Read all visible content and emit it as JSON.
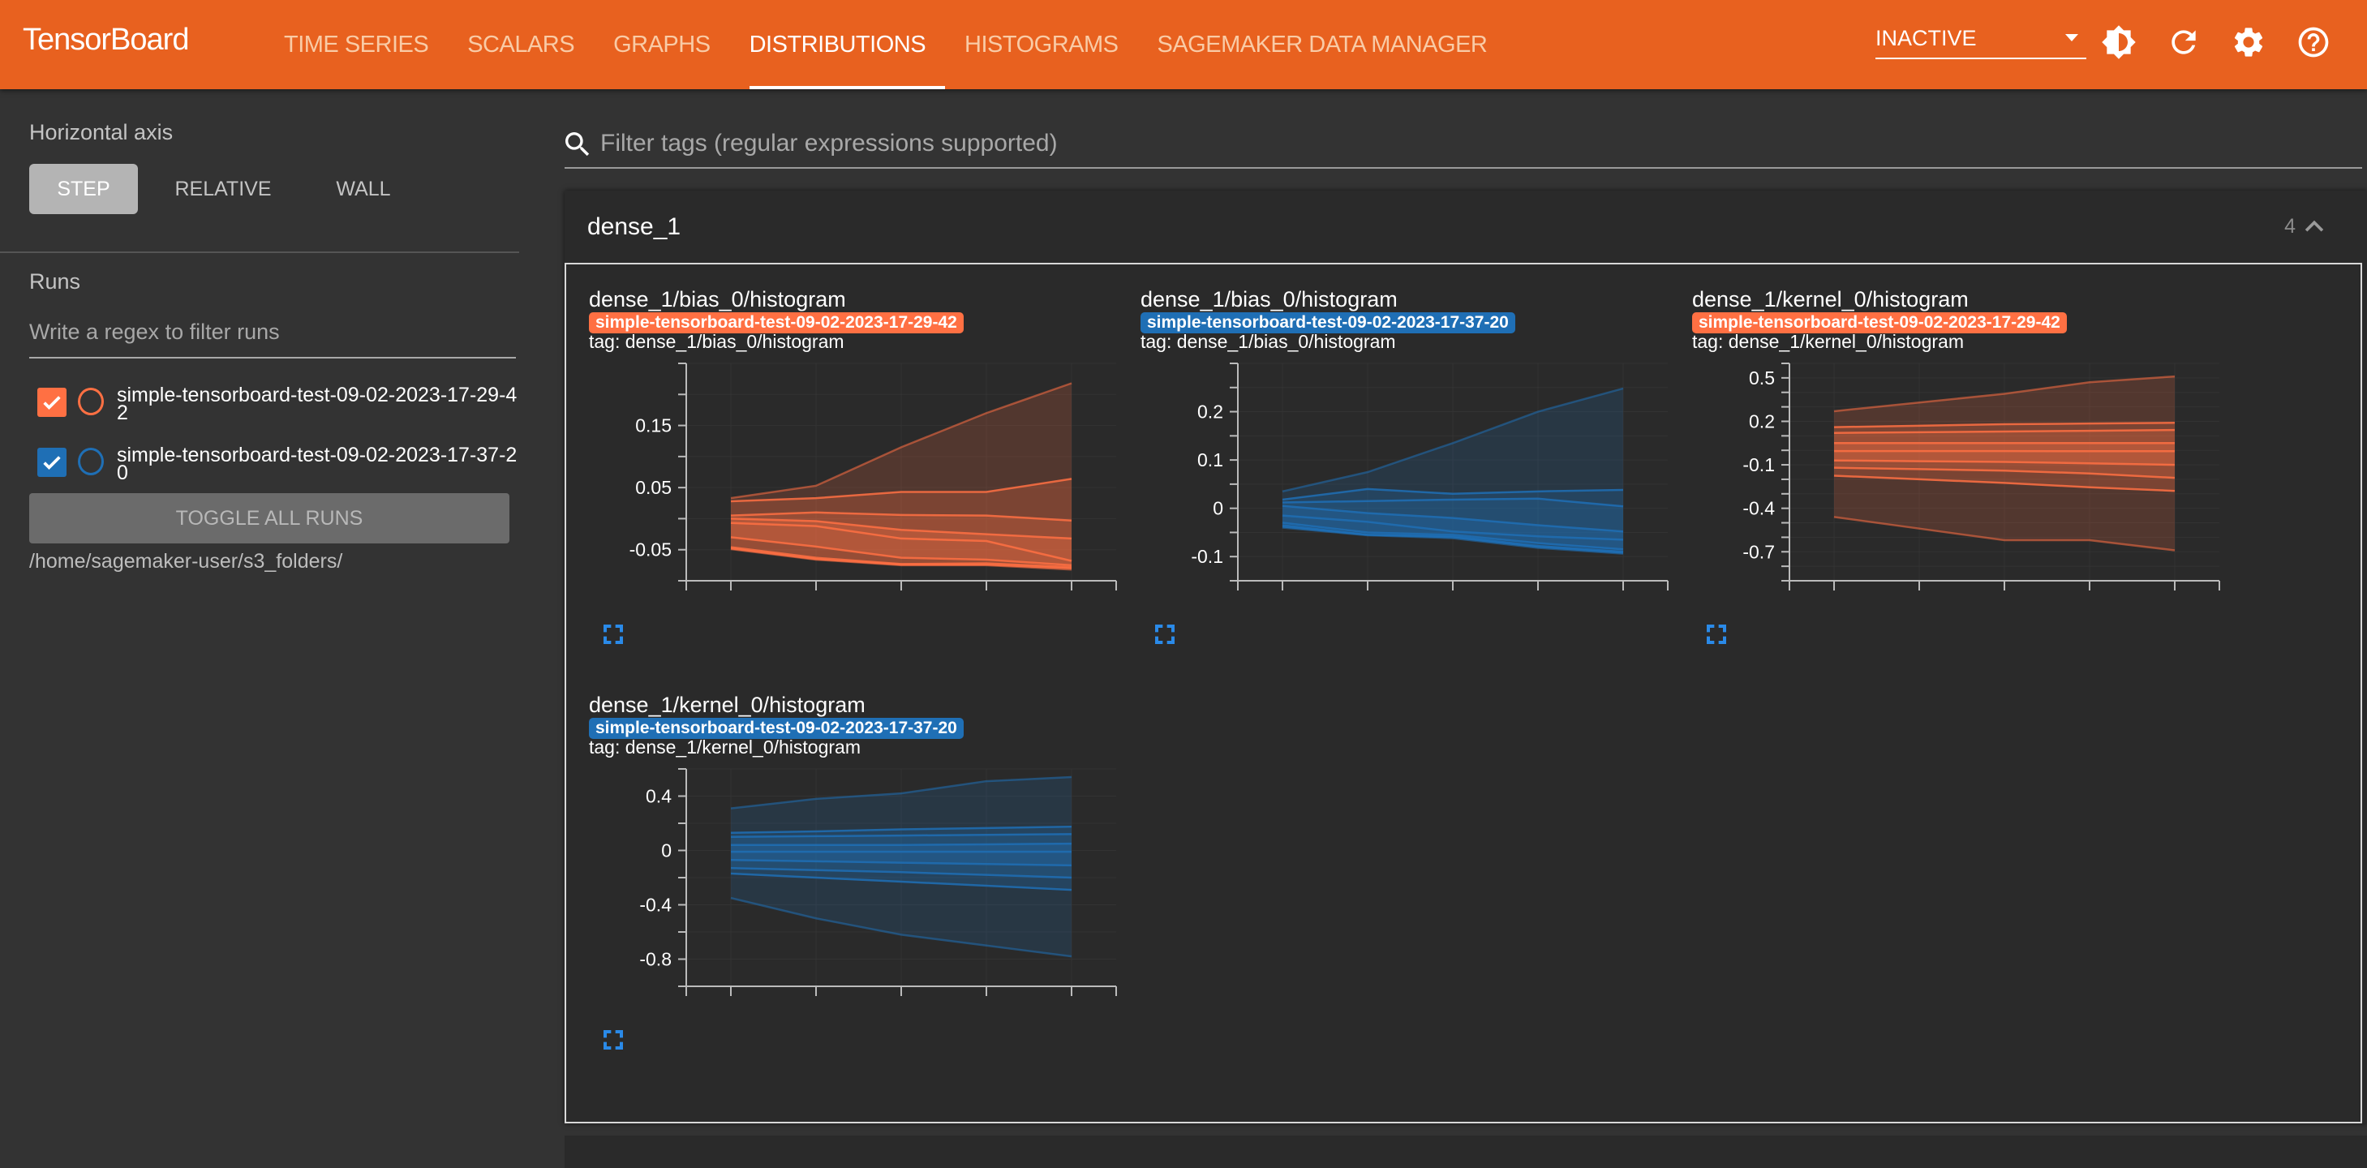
{
  "app": {
    "brand": "TensorBoard",
    "tabs": [
      {
        "label": "TIME SERIES",
        "active": false
      },
      {
        "label": "SCALARS",
        "active": false
      },
      {
        "label": "GRAPHS",
        "active": false
      },
      {
        "label": "DISTRIBUTIONS",
        "active": true
      },
      {
        "label": "HISTOGRAMS",
        "active": false
      },
      {
        "label": "SAGEMAKER DATA MANAGER",
        "active": false
      }
    ],
    "status_select": "INACTIVE",
    "icons": [
      "theme-toggle-icon",
      "reload-icon",
      "settings-icon",
      "help-icon"
    ],
    "accent_color": "#e8611f"
  },
  "sidebar": {
    "horizontal_axis_label": "Horizontal axis",
    "axis_options": [
      {
        "label": "STEP",
        "active": true
      },
      {
        "label": "RELATIVE",
        "active": false
      },
      {
        "label": "WALL",
        "active": false
      }
    ],
    "runs_label": "Runs",
    "runs_filter_placeholder": "Write a regex to filter runs",
    "runs": [
      {
        "name": "simple-tensorboard-test-09-02-2023-17-29-42",
        "checked": true,
        "color": "#ff7043"
      },
      {
        "name": "simple-tensorboard-test-09-02-2023-17-37-20",
        "checked": true,
        "color": "#1f6fb5"
      }
    ],
    "toggle_all_label": "TOGGLE ALL RUNS",
    "logdir": "/home/sagemaker-user/s3_folders/"
  },
  "main": {
    "tag_filter_placeholder": "Filter tags (regular expressions supported)",
    "group": {
      "title": "dense_1",
      "count": "4"
    },
    "panels": [
      {
        "title": "dense_1/bias_0/histogram",
        "run": "simple-tensorboard-test-09-02-2023-17-29-42",
        "run_color": "#ff7043",
        "tag": "tag: dense_1/bias_0/histogram"
      },
      {
        "title": "dense_1/bias_0/histogram",
        "run": "simple-tensorboard-test-09-02-2023-17-37-20",
        "run_color": "#1f6fb5",
        "tag": "tag: dense_1/bias_0/histogram"
      },
      {
        "title": "dense_1/kernel_0/histogram",
        "run": "simple-tensorboard-test-09-02-2023-17-29-42",
        "run_color": "#ff7043",
        "tag": "tag: dense_1/kernel_0/histogram"
      },
      {
        "title": "dense_1/kernel_0/histogram",
        "run": "simple-tensorboard-test-09-02-2023-17-37-20",
        "run_color": "#1f6fb5",
        "tag": "tag: dense_1/kernel_0/histogram"
      }
    ]
  },
  "chart_data": [
    {
      "type": "area",
      "title": "dense_1/bias_0/histogram",
      "series_color": "#ff7043",
      "x": [
        0,
        1,
        2,
        3,
        4
      ],
      "ylim": [
        -0.1,
        0.25
      ],
      "yticks": [
        0.15,
        0.05,
        -0.05
      ],
      "ytick_labels": [
        "0.15",
        "0.05",
        "-0.05"
      ],
      "minor_yticks": [
        0.25,
        0.2,
        0.1,
        0,
        -0.1
      ],
      "grid": true,
      "percentiles": [
        {
          "name": "max",
          "values": [
            0.033,
            0.053,
            0.115,
            0.17,
            0.218
          ]
        },
        {
          "name": "p93",
          "values": [
            0.028,
            0.033,
            0.043,
            0.043,
            0.064
          ]
        },
        {
          "name": "p84",
          "values": [
            0.005,
            0.01,
            0.006,
            0.005,
            -0.003
          ]
        },
        {
          "name": "p69",
          "values": [
            0.0,
            -0.004,
            -0.018,
            -0.025,
            -0.032
          ]
        },
        {
          "name": "p50",
          "values": [
            -0.007,
            -0.012,
            -0.032,
            -0.036,
            -0.068
          ]
        },
        {
          "name": "p31",
          "values": [
            -0.03,
            -0.045,
            -0.063,
            -0.066,
            -0.075
          ]
        },
        {
          "name": "p16",
          "values": [
            -0.046,
            -0.063,
            -0.073,
            -0.072,
            -0.078
          ]
        },
        {
          "name": "p7",
          "values": [
            -0.048,
            -0.065,
            -0.074,
            -0.074,
            -0.08
          ]
        },
        {
          "name": "min",
          "values": [
            -0.049,
            -0.066,
            -0.075,
            -0.075,
            -0.082
          ]
        }
      ]
    },
    {
      "type": "area",
      "title": "dense_1/bias_0/histogram",
      "series_color": "#1f6fb5",
      "x": [
        0,
        1,
        2,
        3,
        4
      ],
      "ylim": [
        -0.15,
        0.3
      ],
      "yticks": [
        0.2,
        0.1,
        0,
        -0.1
      ],
      "ytick_labels": [
        "0.2",
        "0.1",
        "0",
        "-0.1"
      ],
      "minor_yticks": [
        0.3,
        0.25,
        0.15,
        0.05,
        -0.05,
        -0.15
      ],
      "grid": true,
      "percentiles": [
        {
          "name": "max",
          "values": [
            0.035,
            0.075,
            0.135,
            0.2,
            0.248
          ]
        },
        {
          "name": "p93",
          "values": [
            0.018,
            0.04,
            0.03,
            0.035,
            0.038
          ]
        },
        {
          "name": "p84",
          "values": [
            0.012,
            0.015,
            0.018,
            0.02,
            0.004
          ]
        },
        {
          "name": "p69",
          "values": [
            0.005,
            -0.01,
            -0.02,
            -0.035,
            -0.048
          ]
        },
        {
          "name": "p50",
          "values": [
            -0.015,
            -0.028,
            -0.048,
            -0.058,
            -0.065
          ]
        },
        {
          "name": "p31",
          "values": [
            -0.03,
            -0.05,
            -0.055,
            -0.072,
            -0.085
          ]
        },
        {
          "name": "p16",
          "values": [
            -0.035,
            -0.055,
            -0.058,
            -0.078,
            -0.09
          ]
        },
        {
          "name": "p7",
          "values": [
            -0.038,
            -0.055,
            -0.06,
            -0.08,
            -0.092
          ]
        },
        {
          "name": "min",
          "values": [
            -0.04,
            -0.056,
            -0.062,
            -0.082,
            -0.094
          ]
        }
      ]
    },
    {
      "type": "area",
      "title": "dense_1/kernel_0/histogram",
      "series_color": "#ff7043",
      "x": [
        0,
        1,
        2,
        3,
        4
      ],
      "ylim": [
        -0.9,
        0.6
      ],
      "yticks": [
        0.5,
        0.2,
        -0.1,
        -0.4,
        -0.7
      ],
      "ytick_labels": [
        "0.5",
        "0.2",
        "-0.1",
        "-0.4",
        "-0.7"
      ],
      "minor_yticks": [
        0.6,
        0.4,
        0.3,
        0.1,
        0,
        -0.2,
        -0.3,
        -0.5,
        -0.6,
        -0.8,
        -0.9
      ],
      "grid": true,
      "percentiles": [
        {
          "name": "max",
          "values": [
            0.27,
            0.33,
            0.39,
            0.47,
            0.51
          ]
        },
        {
          "name": "p93",
          "values": [
            0.16,
            0.17,
            0.18,
            0.185,
            0.19
          ]
        },
        {
          "name": "p84",
          "values": [
            0.12,
            0.125,
            0.13,
            0.135,
            0.14
          ]
        },
        {
          "name": "p69",
          "values": [
            0.05,
            0.05,
            0.05,
            0.05,
            0.05
          ]
        },
        {
          "name": "p50",
          "values": [
            -0.005,
            -0.005,
            -0.005,
            -0.006,
            -0.006
          ]
        },
        {
          "name": "p31",
          "values": [
            -0.07,
            -0.075,
            -0.08,
            -0.09,
            -0.1
          ]
        },
        {
          "name": "p16",
          "values": [
            -0.12,
            -0.13,
            -0.14,
            -0.16,
            -0.19
          ]
        },
        {
          "name": "p7",
          "values": [
            -0.175,
            -0.2,
            -0.225,
            -0.255,
            -0.28
          ]
        },
        {
          "name": "min",
          "values": [
            -0.46,
            -0.54,
            -0.62,
            -0.62,
            -0.69
          ]
        }
      ]
    },
    {
      "type": "area",
      "title": "dense_1/kernel_0/histogram",
      "series_color": "#1f6fb5",
      "x": [
        0,
        1,
        2,
        3,
        4
      ],
      "ylim": [
        -1.0,
        0.6
      ],
      "yticks": [
        0.4,
        0,
        -0.4,
        -0.8
      ],
      "ytick_labels": [
        "0.4",
        "0",
        "-0.4",
        "-0.8"
      ],
      "minor_yticks": [
        0.6,
        0.2,
        -0.2,
        -0.6,
        -1.0
      ],
      "grid": true,
      "percentiles": [
        {
          "name": "max",
          "values": [
            0.31,
            0.38,
            0.42,
            0.51,
            0.54
          ]
        },
        {
          "name": "p93",
          "values": [
            0.13,
            0.14,
            0.155,
            0.165,
            0.175
          ]
        },
        {
          "name": "p84",
          "values": [
            0.1,
            0.105,
            0.11,
            0.115,
            0.12
          ]
        },
        {
          "name": "p69",
          "values": [
            0.04,
            0.04,
            0.04,
            0.045,
            0.05
          ]
        },
        {
          "name": "p50",
          "values": [
            -0.01,
            -0.01,
            -0.01,
            -0.01,
            -0.01
          ]
        },
        {
          "name": "p31",
          "values": [
            -0.07,
            -0.08,
            -0.09,
            -0.1,
            -0.11
          ]
        },
        {
          "name": "p16",
          "values": [
            -0.13,
            -0.145,
            -0.16,
            -0.18,
            -0.2
          ]
        },
        {
          "name": "p7",
          "values": [
            -0.17,
            -0.2,
            -0.23,
            -0.26,
            -0.29
          ]
        },
        {
          "name": "min",
          "values": [
            -0.35,
            -0.5,
            -0.62,
            -0.7,
            -0.78
          ]
        }
      ]
    }
  ]
}
